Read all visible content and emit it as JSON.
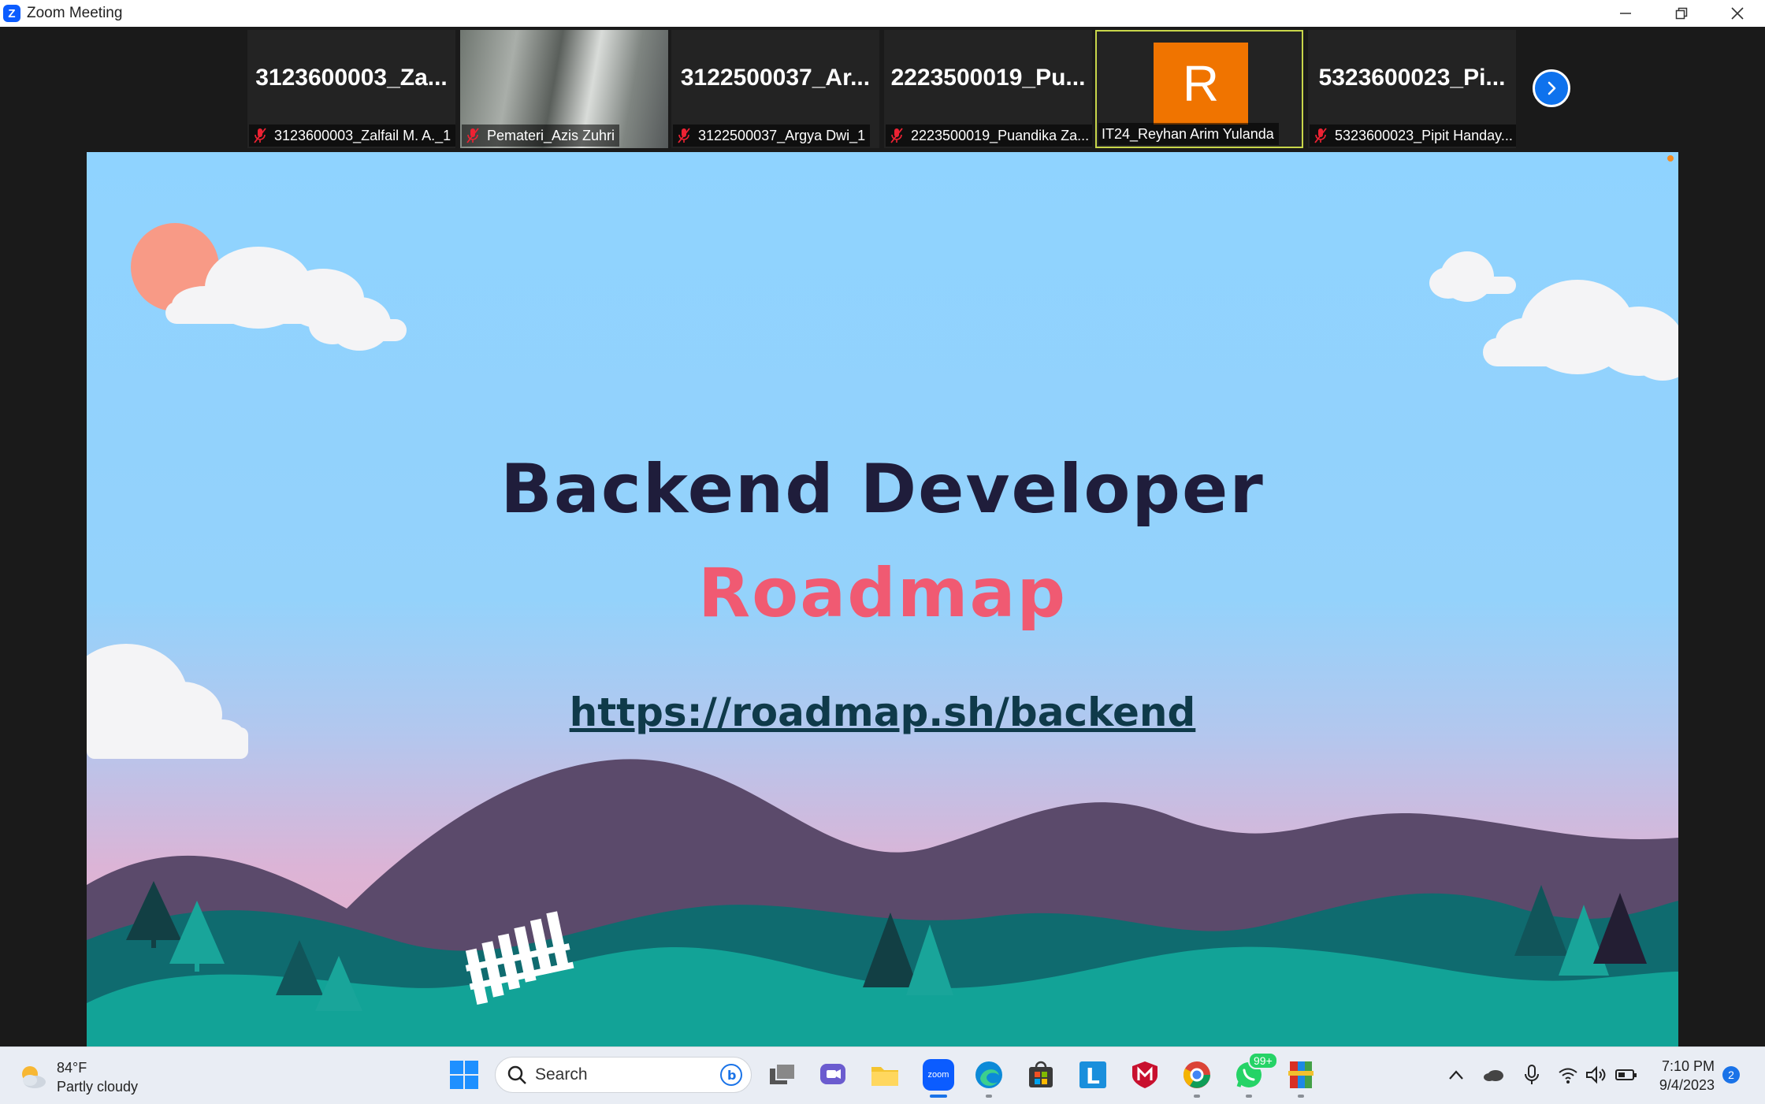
{
  "window": {
    "title": "Zoom Meeting"
  },
  "gallery": {
    "tiles": [
      {
        "name": "3123600003_Za...",
        "label": "3123600003_Zalfail M. A._1"
      },
      {
        "name": "",
        "label": "Pemateri_Azis Zuhri"
      },
      {
        "name": "3122500037_Ar...",
        "label": "3122500037_Argya Dwi_1"
      },
      {
        "name": "2223500019_Pu...",
        "label": "2223500019_Puandika Za..."
      },
      {
        "name": "R",
        "label": "IT24_Reyhan Arim Yulanda"
      },
      {
        "name": "5323600023_Pi...",
        "label": "5323600023_Pipit Handay..."
      }
    ]
  },
  "slide": {
    "title": "Backend Developer",
    "subtitle": "Roadmap",
    "link": "https://roadmap.sh/backend"
  },
  "taskbar": {
    "weather_temp": "84°F",
    "weather_desc": "Partly cloudy",
    "search_placeholder": "Search",
    "zoom_label": "zoom",
    "whatsapp_badge": "99+",
    "time": "7:10 PM",
    "date": "9/4/2023",
    "notifications": "2"
  },
  "colors": {
    "accent": "#0e72ed",
    "active_speaker": "#c8d64a",
    "avatar": "#f07400",
    "roadmap": "#f05a72"
  }
}
